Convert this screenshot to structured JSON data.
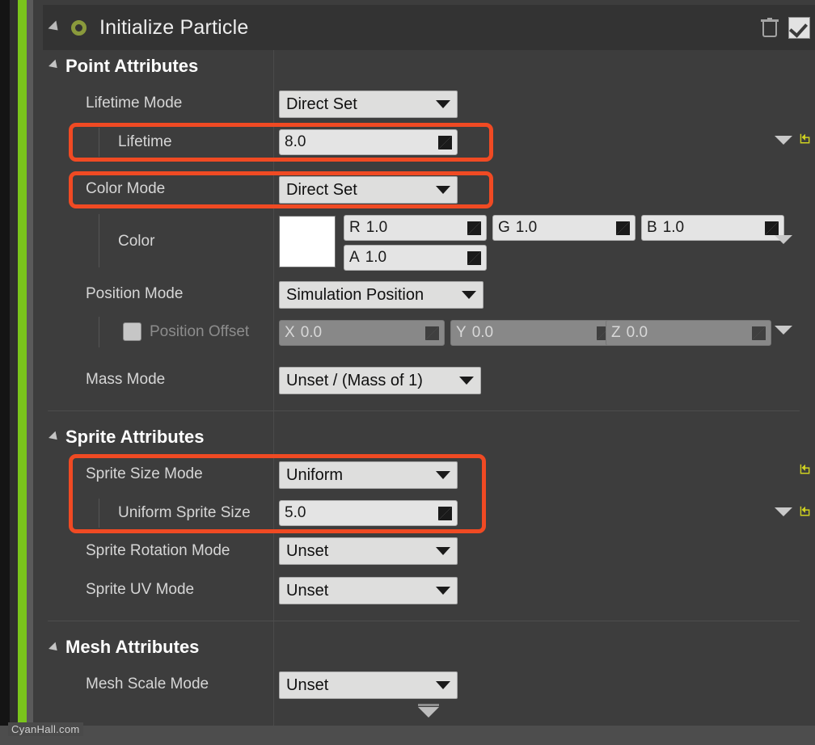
{
  "header": {
    "title": "Initialize Particle",
    "collapse_icon": "triangle-collapse-icon",
    "module_icon": "green-ring-icon",
    "delete_icon": "trash-icon",
    "enabled_checkbox": "checkbox-checked"
  },
  "sections": {
    "point": {
      "label": "Point Attributes"
    },
    "sprite": {
      "label": "Sprite Attributes"
    },
    "mesh": {
      "label": "Mesh Attributes"
    }
  },
  "rows": {
    "lifetime_mode": {
      "label": "Lifetime Mode",
      "value": "Direct Set"
    },
    "lifetime": {
      "label": "Lifetime",
      "value": "8.0"
    },
    "color_mode": {
      "label": "Color Mode",
      "value": "Direct Set"
    },
    "color": {
      "label": "Color",
      "swatch": "#ffffff",
      "r": {
        "prefix": "R",
        "value": "1.0"
      },
      "g": {
        "prefix": "G",
        "value": "1.0"
      },
      "b": {
        "prefix": "B",
        "value": "1.0"
      },
      "a": {
        "prefix": "A",
        "value": "1.0"
      }
    },
    "position_mode": {
      "label": "Position Mode",
      "value": "Simulation Position"
    },
    "position_offset": {
      "label": "Position Offset",
      "checkbox": "unchecked",
      "x": {
        "prefix": "X",
        "value": "0.0"
      },
      "y": {
        "prefix": "Y",
        "value": "0.0"
      },
      "z": {
        "prefix": "Z",
        "value": "0.0"
      }
    },
    "mass_mode": {
      "label": "Mass Mode",
      "value": "Unset / (Mass of 1)"
    },
    "sprite_size_mode": {
      "label": "Sprite Size Mode",
      "value": "Uniform"
    },
    "uniform_sprite_size": {
      "label": "Uniform Sprite Size",
      "value": "5.0"
    },
    "sprite_rotation_mode": {
      "label": "Sprite Rotation Mode",
      "value": "Unset"
    },
    "sprite_uv_mode": {
      "label": "Sprite UV Mode",
      "value": "Unset"
    },
    "mesh_scale_mode": {
      "label": "Mesh Scale Mode",
      "value": "Unset"
    }
  },
  "icons": {
    "expand_chevron": "chevron-down-icon",
    "reset_arrow": "reset-to-default-icon",
    "drag_grip": "drag-handle-icon",
    "footer_expand": "expand-down-icon"
  },
  "colors": {
    "accent_green": "#7ac51c",
    "highlight_red": "#f04a23",
    "module_ring": "#8a9a3c",
    "panel_bg": "#3d3d3d",
    "header_bg": "#333333"
  },
  "watermark": {
    "text": "CyanHall.com"
  }
}
